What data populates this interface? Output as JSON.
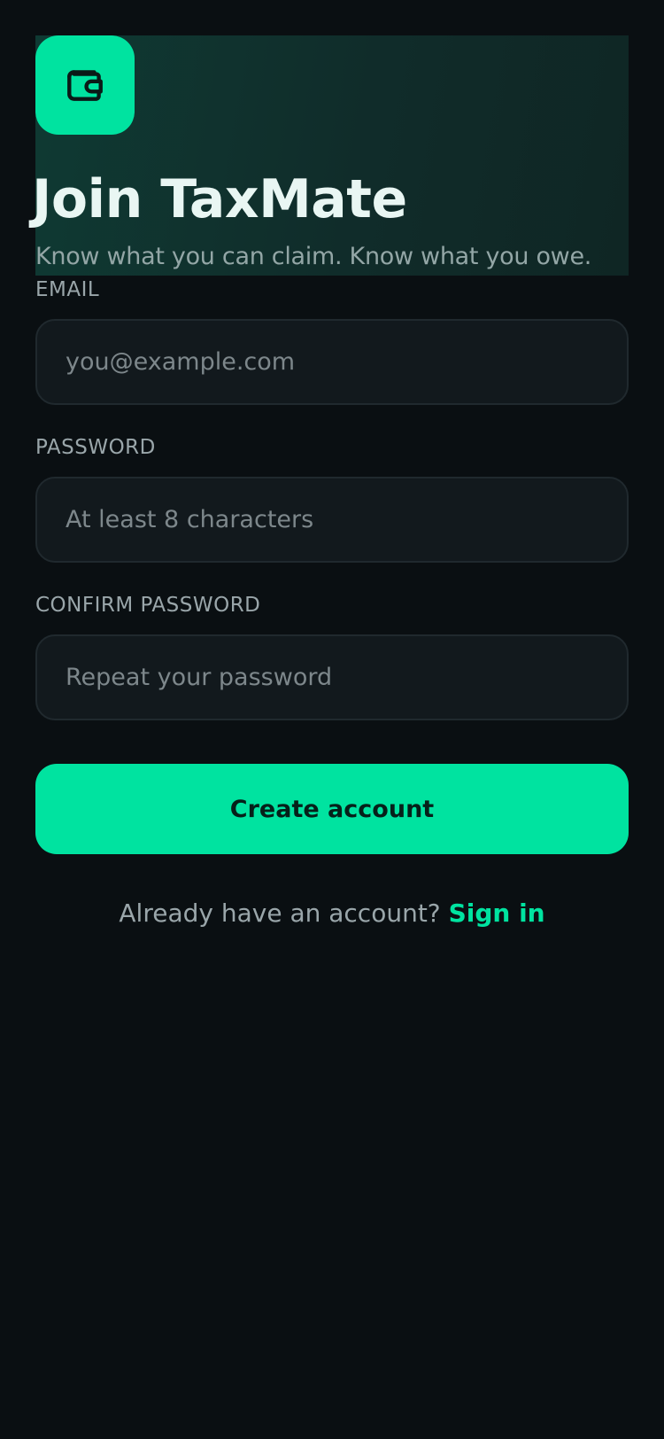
{
  "brand": {
    "logo_icon": "wallet-icon",
    "accent_color": "#00e3a0",
    "background_color": "#0a0f12"
  },
  "header": {
    "title": "Join TaxMate",
    "subtitle": "Know what you can claim. Know what you owe."
  },
  "form": {
    "email": {
      "label": "EMAIL",
      "placeholder": "you@example.com",
      "value": ""
    },
    "password": {
      "label": "PASSWORD",
      "placeholder": "At least 8 characters",
      "value": ""
    },
    "confirm_password": {
      "label": "CONFIRM PASSWORD",
      "placeholder": "Repeat your password",
      "value": ""
    },
    "submit_label": "Create account"
  },
  "footer": {
    "prompt": "Already have an account?",
    "link_label": "Sign in"
  }
}
